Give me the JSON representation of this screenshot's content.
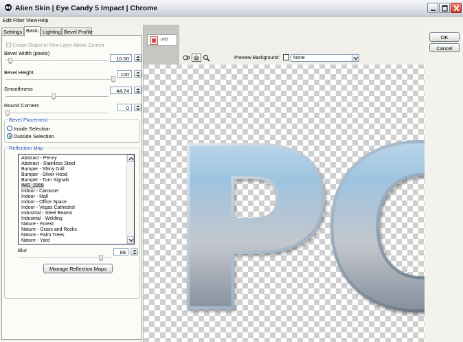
{
  "window": {
    "title": "Alien Skin | Eye Candy 5 Impact | Chrome"
  },
  "menu": [
    "Edit",
    "Filter",
    "View",
    "Help"
  ],
  "tabs": [
    {
      "label": "Settings",
      "active": false
    },
    {
      "label": "Basic",
      "active": true
    },
    {
      "label": "Lighting",
      "active": false
    },
    {
      "label": "Bevel Profile",
      "active": false
    }
  ],
  "basic": {
    "create_output_label": "Create Output In New Layer Above Current",
    "create_output_checked": false,
    "bevel_width": {
      "label": "Bevel Width (pixels)",
      "value": "10.00",
      "slider": 0.04
    },
    "bevel_height": {
      "label": "Bevel Height",
      "value": "100",
      "slider": 1.0
    },
    "smoothness": {
      "label": "Smoothness",
      "value": "44.74",
      "slider": 0.45
    },
    "round_corners": {
      "label": "Round Corners",
      "value": "0",
      "slider": 0.0
    }
  },
  "bevel_placement": {
    "title": "Bevel Placement",
    "options": [
      {
        "label": "Inside Selection",
        "selected": false
      },
      {
        "label": "Outside Selection",
        "selected": true
      }
    ]
  },
  "reflection_map": {
    "title": "Reflection Map",
    "items": [
      "Abstract - Penny",
      "Abstract - Stainless Steel",
      "Bumper - Shiny Grill",
      "Bumper - Silver Hood",
      "Bumper - Turn Signals",
      "IMG_2269",
      "Indoor - Carousel",
      "Indoor - Mall",
      "Indoor - Office Space",
      "Indoor - Vegas Cathedral",
      "Industrial - Steel Beams",
      "Industrial - Welding",
      "Nature - Forest",
      "Nature - Grass and Rocks",
      "Nature - Palm Trees",
      "Nature - Yard"
    ],
    "selected_index": 5,
    "blur": {
      "label": "Blur",
      "value": "88",
      "slider": 0.88
    },
    "manage_button": "Manage Reflection Maps"
  },
  "preview": {
    "thumbnail_label": "orld",
    "background_label": "Preview Background:",
    "background_value": "None",
    "text": "PC"
  },
  "buttons": {
    "ok": "OK",
    "cancel": "Cancel"
  },
  "icons": {
    "app": "alien-skin-icon",
    "tools": [
      "navigate-icon",
      "hand-icon",
      "zoom-icon"
    ]
  }
}
